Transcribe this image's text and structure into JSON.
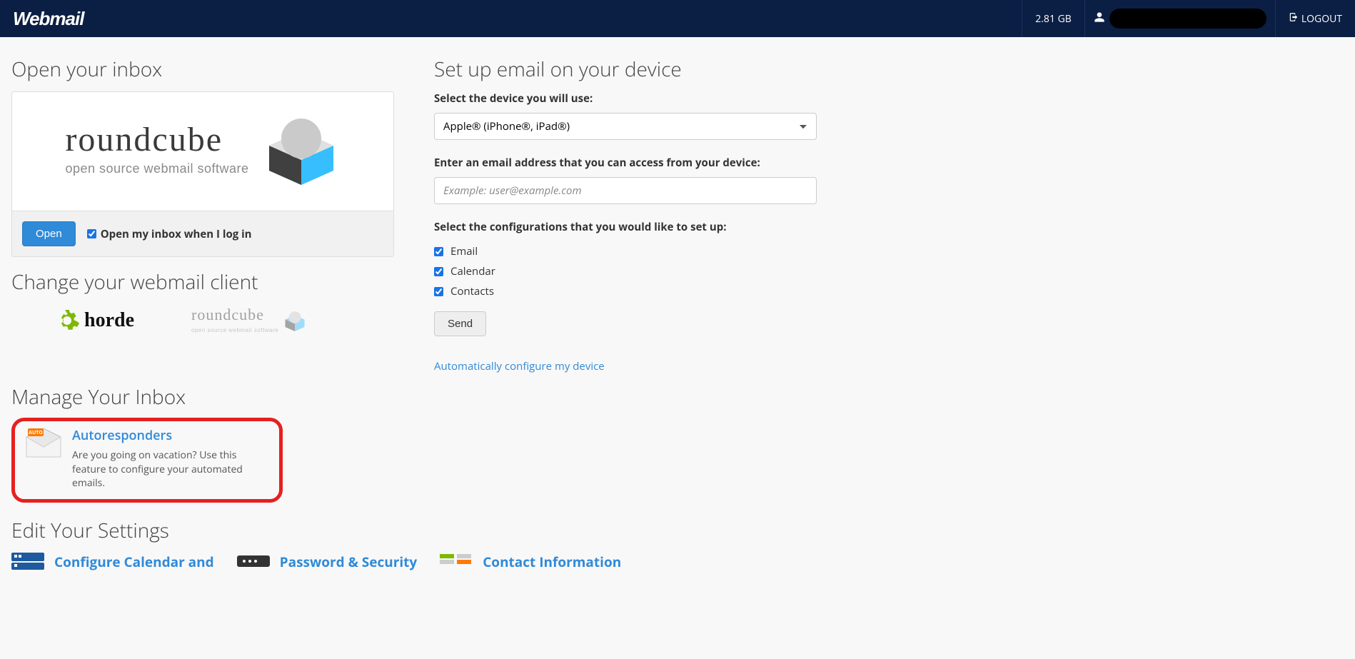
{
  "header": {
    "logo": "Webmail",
    "storage": "2.81 GB",
    "logout": "LOGOUT"
  },
  "inbox": {
    "heading": "Open your inbox",
    "client_name": "roundcube",
    "client_tagline": "open source webmail software",
    "open_button": "Open",
    "auto_open_label": "Open my inbox when I log in",
    "auto_open_checked": true
  },
  "change_client": {
    "heading": "Change your webmail client",
    "options": [
      "horde",
      "roundcube"
    ]
  },
  "manage_inbox": {
    "heading": "Manage Your Inbox",
    "items": [
      {
        "title": "Autoresponders",
        "desc": "Are you going on vacation? Use this feature to configure your automated emails."
      }
    ]
  },
  "edit_settings": {
    "heading": "Edit Your Settings",
    "items": [
      {
        "title": "Configure Calendar and"
      },
      {
        "title": "Password & Security"
      },
      {
        "title": "Contact Information"
      }
    ]
  },
  "device_setup": {
    "heading": "Set up email on your device",
    "device_label": "Select the device you will use:",
    "device_value": "Apple® (iPhone®, iPad®)",
    "email_label": "Enter an email address that you can access from your device:",
    "email_placeholder": "Example: user@example.com",
    "email_value": "",
    "config_label": "Select the configurations that you would like to set up:",
    "configs": [
      {
        "label": "Email",
        "checked": true
      },
      {
        "label": "Calendar",
        "checked": true
      },
      {
        "label": "Contacts",
        "checked": true
      }
    ],
    "send_button": "Send",
    "auto_link": "Automatically configure my device"
  }
}
